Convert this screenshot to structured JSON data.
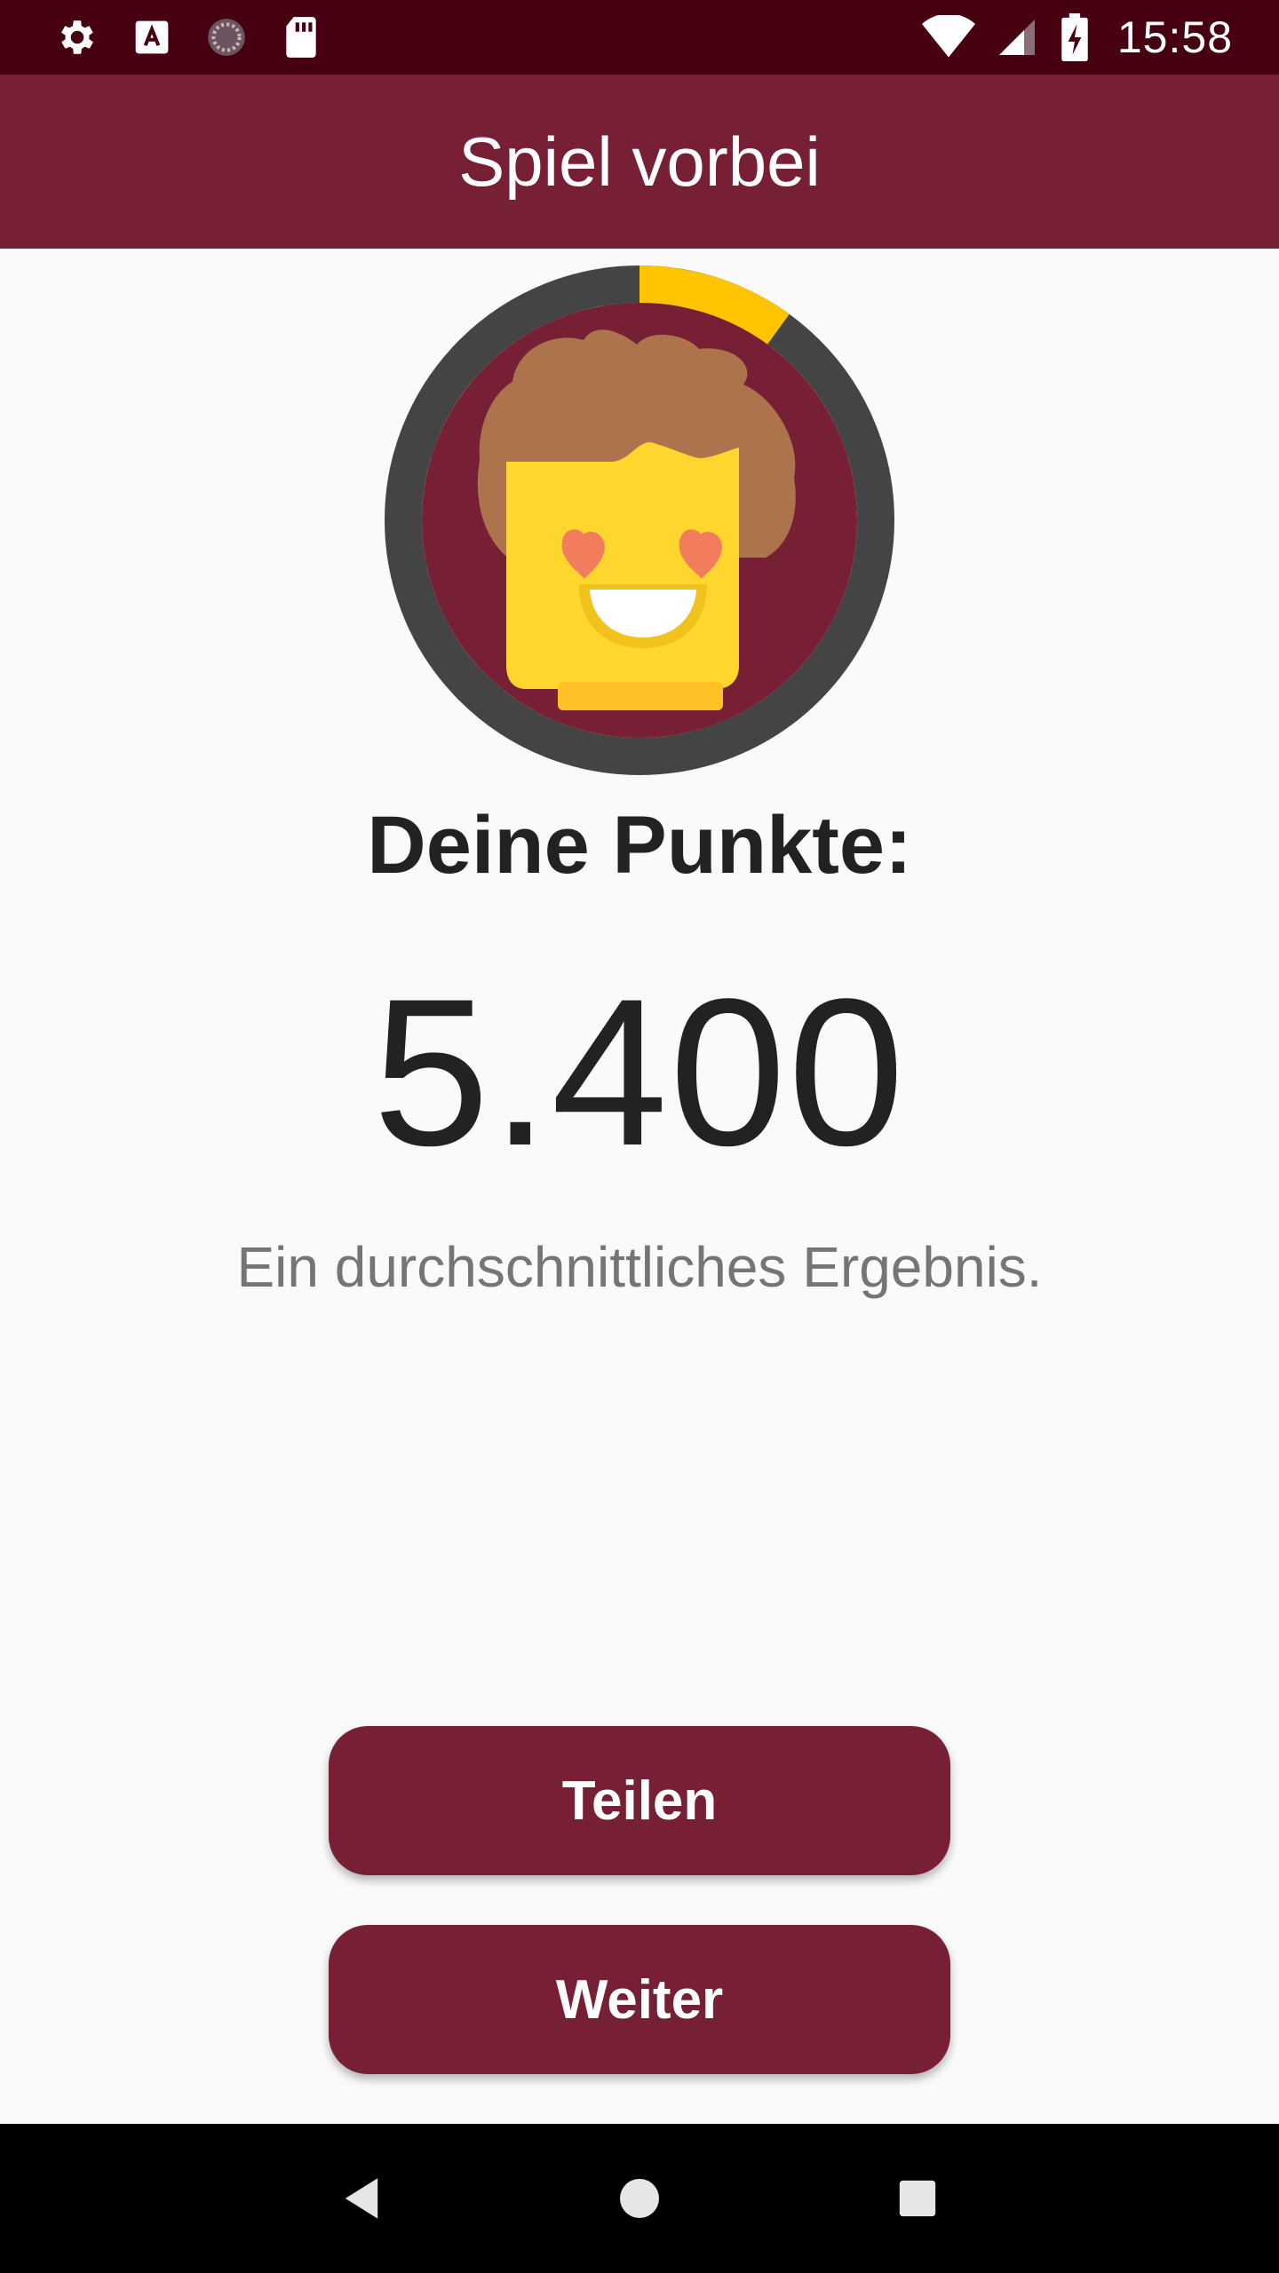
{
  "status_bar": {
    "time": "15:58",
    "icons_left": [
      "settings-icon",
      "font-icon",
      "sync-icon",
      "sd-card-icon"
    ],
    "icons_right": [
      "wifi-icon",
      "signal-icon",
      "battery-charging-icon"
    ]
  },
  "app_bar": {
    "title": "Spiel vorbei"
  },
  "avatar": {
    "progress": 0.1,
    "ring_color": "#444444",
    "progress_color": "#ffc400",
    "bg_color": "#771f35"
  },
  "score": {
    "label": "Deine Punkte:",
    "value": "5.400",
    "comment": "Ein durchschnittliches Ergebnis."
  },
  "buttons": {
    "share": "Teilen",
    "next": "Weiter"
  },
  "nav_bar": {
    "icons": [
      "back-icon",
      "home-icon",
      "recents-icon"
    ]
  },
  "colors": {
    "primary": "#771f35",
    "status_bar": "#460010"
  }
}
